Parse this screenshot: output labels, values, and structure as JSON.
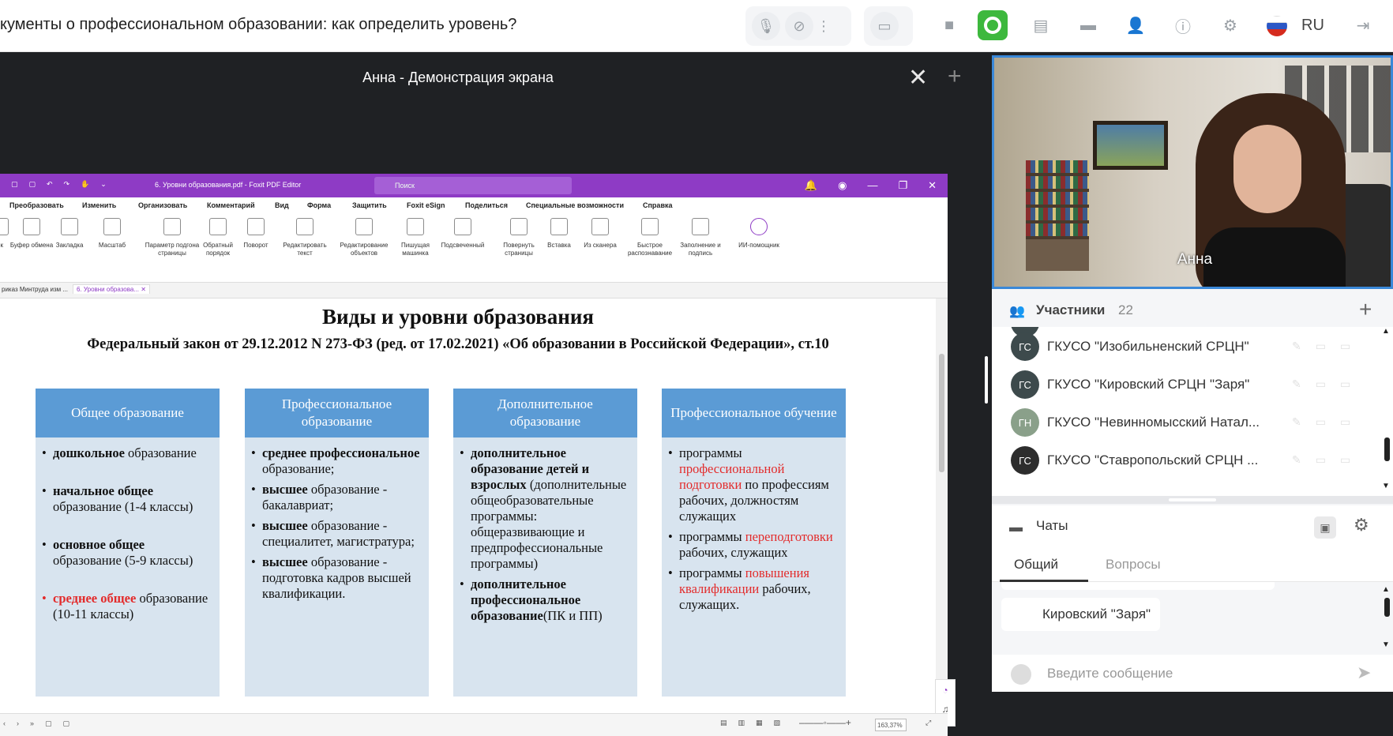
{
  "topbar": {
    "meeting_title": "кументы о профессиональном образовании: как определить уровень?",
    "language": "RU",
    "accent_green": "#3db83d"
  },
  "share": {
    "title": "Анна - Демонстрация экрана"
  },
  "foxit": {
    "doc_title": "6. Уровни образования.pdf - Foxit PDF Editor",
    "search_placeholder": "Поиск",
    "menu": [
      "Преобразовать",
      "Изменить",
      "Организовать",
      "Комментарий",
      "Вид",
      "Форма",
      "Защитить",
      "Foxit eSign",
      "Поделиться",
      "Специальные возможности",
      "Справка"
    ],
    "ribbon": [
      {
        "label": "ок",
        "icon": "pointer-icon"
      },
      {
        "label": "Буфер обмена",
        "icon": "clipboard-icon"
      },
      {
        "label": "Закладка",
        "icon": "bookmark-icon"
      },
      {
        "label": "Масштаб",
        "icon": "zoom-icon"
      },
      {
        "label": "Параметр подгона страницы",
        "icon": "fit-page-icon"
      },
      {
        "label": "Обратный порядок",
        "icon": "reverse-icon"
      },
      {
        "label": "Поворот",
        "icon": "rotate-icon"
      },
      {
        "label": "Редактировать текст",
        "icon": "edit-text-icon"
      },
      {
        "label": "Редактирование объектов",
        "icon": "edit-object-icon"
      },
      {
        "label": "Пишущая машинка",
        "icon": "typewriter-icon"
      },
      {
        "label": "Подсвеченный",
        "icon": "highlight-icon"
      },
      {
        "label": "Повернуть страницы",
        "icon": "rotate-pages-icon"
      },
      {
        "label": "Вставка",
        "icon": "insert-icon"
      },
      {
        "label": "Из сканера",
        "icon": "scanner-icon"
      },
      {
        "label": "Быстрое распознавание",
        "icon": "ocr-icon"
      },
      {
        "label": "Заполнение и подпись",
        "icon": "sign-icon"
      },
      {
        "label": "ИИ-помощник",
        "icon": "ai-assistant-icon"
      }
    ],
    "tabs": [
      "риказ Минтруда изм ...",
      "6. Уровни образова..."
    ],
    "zoom": "163,37%"
  },
  "document": {
    "heading": "Виды и уровни образования",
    "subheading": "Федеральный закон от 29.12.2012 N 273-ФЗ (ред. от 17.02.2021) «Об образовании в Российской Федерации», ст.10",
    "columns": [
      {
        "head": "Общее образование",
        "items": [
          {
            "bold": "дошкольное",
            "rest": " образование",
            "red": false
          },
          {
            "bold": "начальное общее",
            "rest": " образование (1-4 классы)",
            "red": false
          },
          {
            "bold": "основное общее",
            "rest": " образование (5-9 классы)",
            "red": false
          },
          {
            "bold": "среднее общее",
            "rest": " образование (10-11 классы)",
            "red": true
          }
        ]
      },
      {
        "head": "Профессиональное образование",
        "items": [
          {
            "bold": "среднее профессиональное",
            "rest": " образование;"
          },
          {
            "bold": "высшее",
            "rest": " образование - бакалавриат;"
          },
          {
            "bold": "высшее",
            "rest": " образование - специалитет, магистратура;"
          },
          {
            "bold": "высшее",
            "rest": " образование - подготовка кадров высшей квалификации."
          }
        ]
      },
      {
        "head": "Дополнительное образование",
        "items": [
          {
            "bold": "дополнительное образование детей и взрослых",
            "rest": " (дополнительные общеобразовательные программы: общеразвивающие и предпрофессиональные программы)"
          },
          {
            "bold": "дополнительное профессиональное образование",
            "rest": "(ПК и ПП)"
          }
        ]
      },
      {
        "head": "Профессиональное обучение",
        "items": [
          {
            "pre": "программы ",
            "red": "профессиональной подготовки",
            "post": " по профессиям рабочих, должностям служащих"
          },
          {
            "pre": " программы ",
            "red": "переподготовки",
            "post": " рабочих, служащих"
          },
          {
            "pre": " программы ",
            "red": "повышения квалификации",
            "post": " рабочих, служащих."
          }
        ]
      }
    ]
  },
  "video": {
    "name": "Анна"
  },
  "participants": {
    "title": "Участники",
    "count": "22",
    "list": [
      {
        "initials": "ГС",
        "name": "ГКУСО \"Изобильненский СРЦН\"",
        "color": "#3d4a4c"
      },
      {
        "initials": "ГС",
        "name": "ГКУСО \"Кировский СРЦН \"Заря\"",
        "color": "#3d4a4c"
      },
      {
        "initials": "ГН",
        "name": "ГКУСО \"Невинномысский Натал...",
        "color": "#8aa08a"
      },
      {
        "initials": "ГС",
        "name": "ГКУСО \"Ставропольский СРЦН ...",
        "color": "#2d2d2d"
      }
    ]
  },
  "chats": {
    "title": "Чаты",
    "tabs": [
      "Общий",
      "Вопросы"
    ],
    "message": "Кировский \"Заря\"",
    "input_placeholder": "Введите сообщение"
  }
}
